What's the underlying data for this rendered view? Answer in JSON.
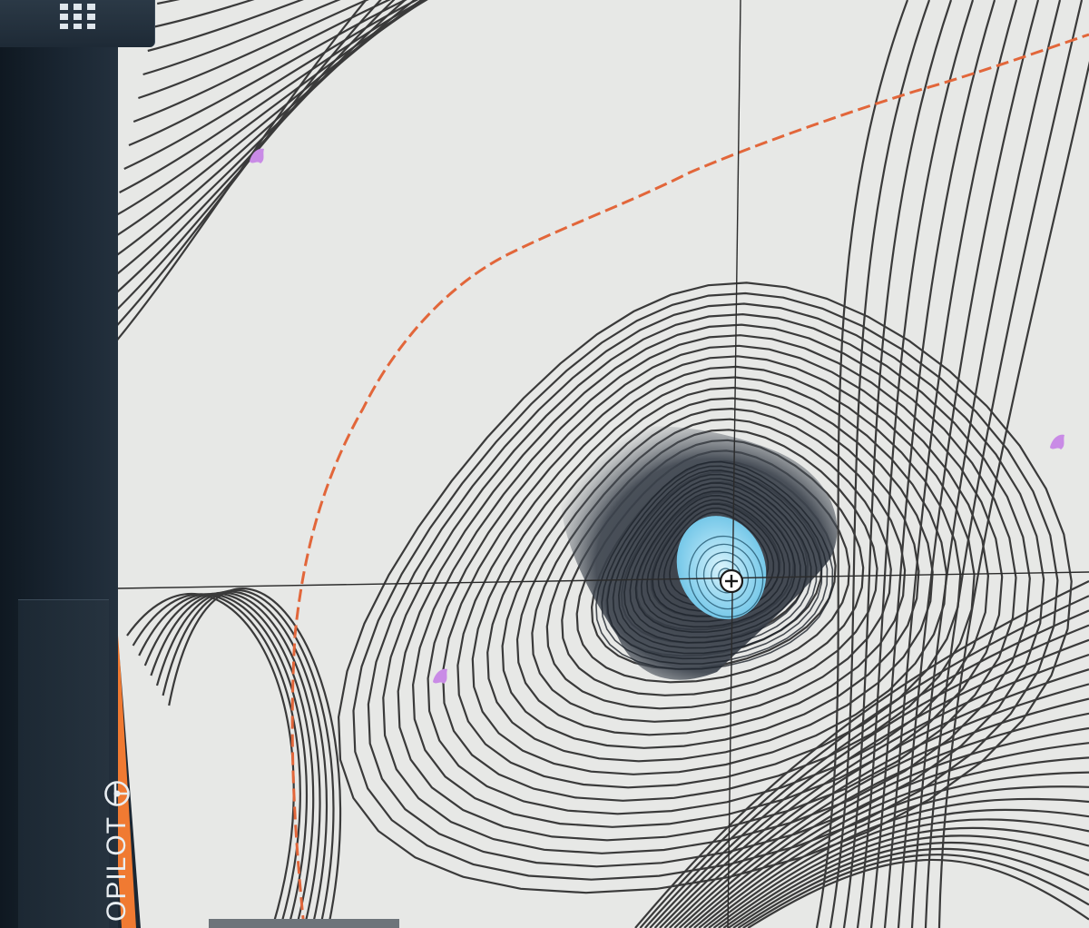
{
  "app": {
    "menu_icon": "grid-menu-icon"
  },
  "side_panel": {
    "autopilot_label": "OPILOT",
    "autopilot_icon": "steering-wheel-icon"
  },
  "map": {
    "type": "bathymetric contour chart",
    "colors": {
      "land_background": "#e7e8e6",
      "contour_line": "#3a3a3a",
      "deep_shading": "#2e3540",
      "shallow_water": "#8fd3ee",
      "route_line": "#e2663a",
      "border_accent": "#f07a32",
      "marker": "#c98be6"
    },
    "cursor_icon": "crosshair-cursor-icon",
    "marker_icon": "fish-marker-icon",
    "marker_count": 3
  }
}
